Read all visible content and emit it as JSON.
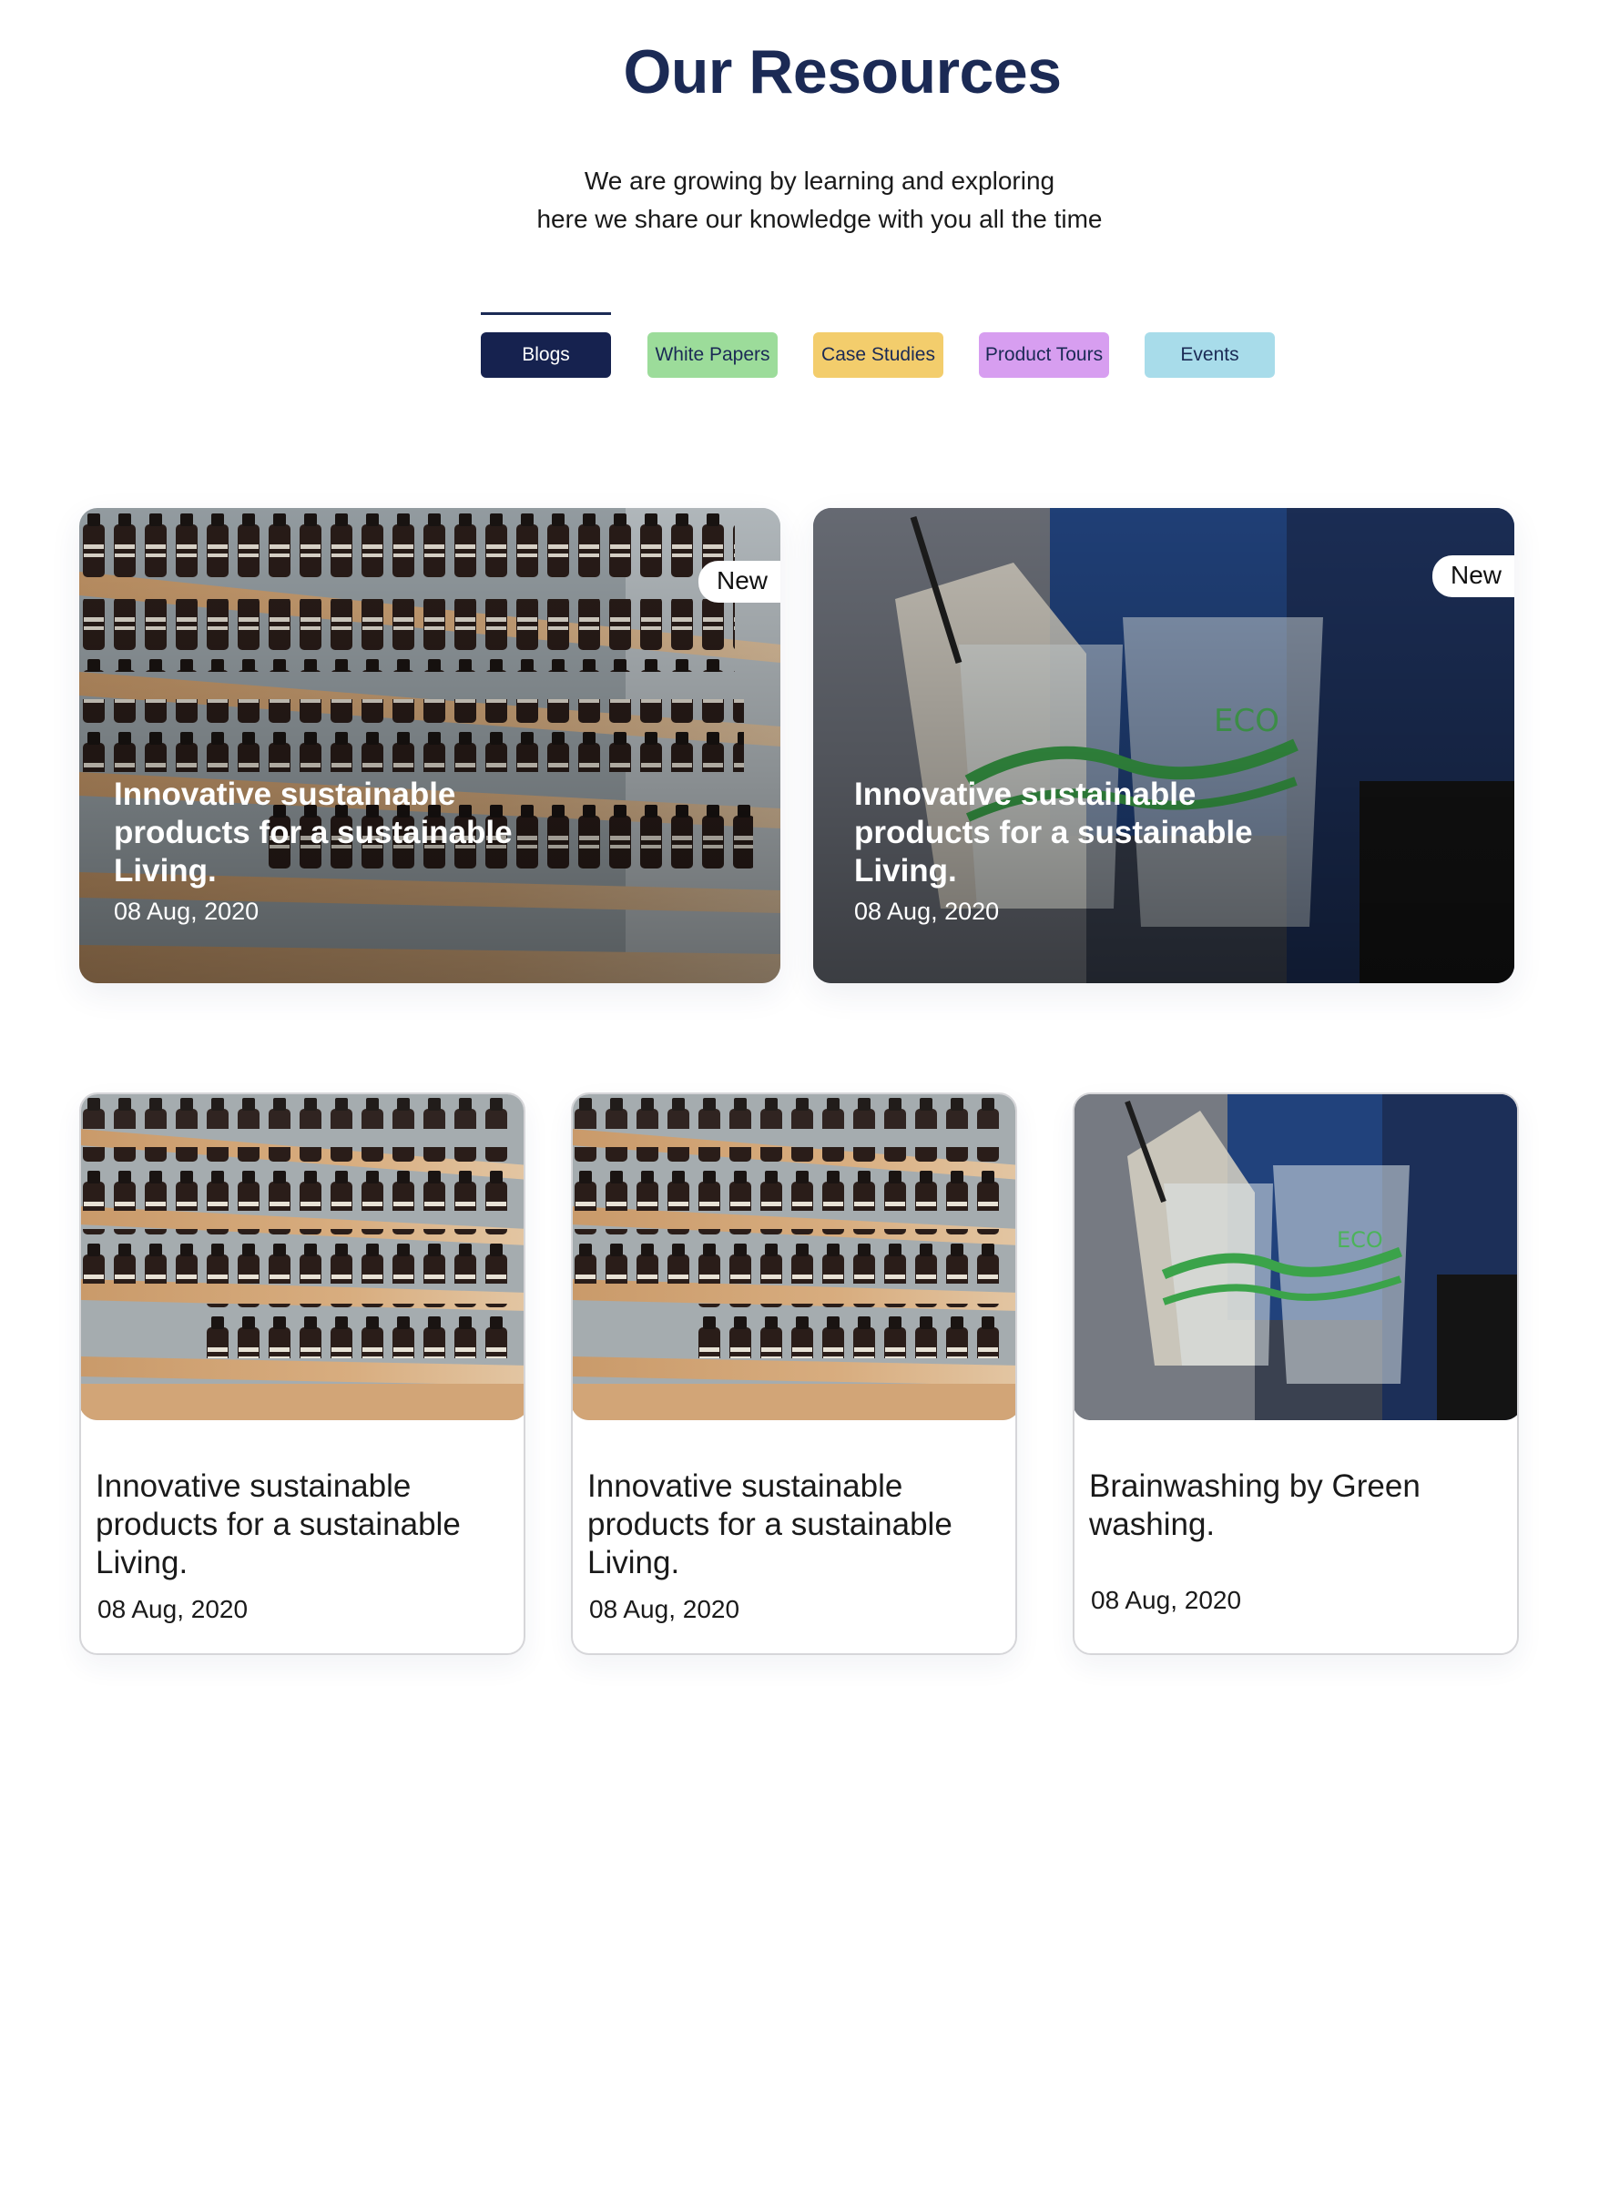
{
  "header": {
    "title": "Our Resources",
    "subtitle_line1": "We are growing by learning and exploring",
    "subtitle_line2": "here we share our knowledge with you all the time"
  },
  "tabs": [
    {
      "label": "Blogs",
      "color": "#16224f",
      "text_color": "#ffffff",
      "active": true
    },
    {
      "label": "White Papers",
      "color": "#9cdc9a",
      "text_color": "#1b2a55",
      "active": false
    },
    {
      "label": "Case Studies",
      "color": "#f3cd6c",
      "text_color": "#1b2a55",
      "active": false
    },
    {
      "label": "Product Tours",
      "color": "#d79ef0",
      "text_color": "#1b2a55",
      "active": false
    },
    {
      "label": "Events",
      "color": "#a8dcea",
      "text_color": "#1b2a55",
      "active": false
    }
  ],
  "featured": [
    {
      "badge": "New",
      "title": "Innovative sustainable products for a sustainable Living.",
      "date": "08 Aug, 2020",
      "image": "shelf-photo"
    },
    {
      "badge": "New",
      "title": "Innovative sustainable products for a sustainable Living.",
      "date": "08 Aug, 2020",
      "image": "eco-cups-photo"
    }
  ],
  "posts": [
    {
      "title": "Innovative sustainable products for a sustainable Living.",
      "date": "08 Aug, 2020",
      "image": "shelf-photo"
    },
    {
      "title": "Innovative sustainable products for a sustainable Living.",
      "date": "08 Aug, 2020",
      "image": "shelf-photo"
    },
    {
      "title": "Brainwashing by Green washing.",
      "date": "08 Aug, 2020",
      "image": "eco-cups-photo"
    }
  ]
}
